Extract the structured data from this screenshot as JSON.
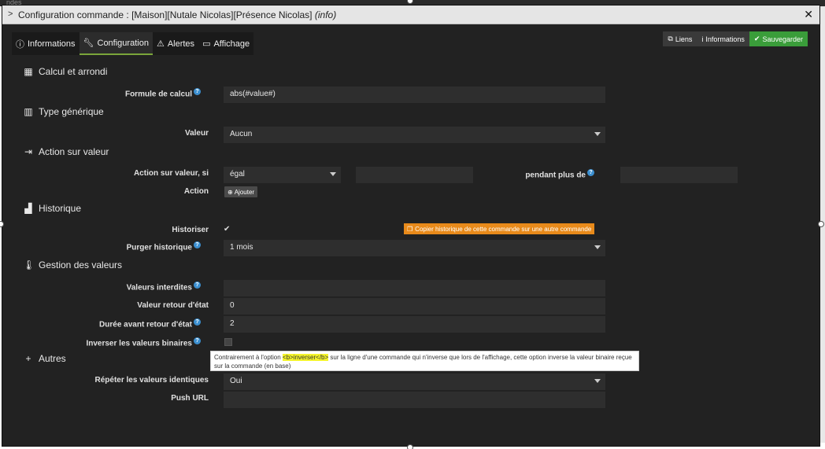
{
  "background": {
    "text": "ndes"
  },
  "title": {
    "prefix": "Configuration commande : [Maison][Nutale Nicolas][Présence Nicolas]",
    "suffix": "(info)",
    "close": "✕"
  },
  "tabs": [
    {
      "label": "Informations",
      "icon": "info-circle-icon"
    },
    {
      "label": "Configuration",
      "icon": "wrench-icon"
    },
    {
      "label": "Alertes",
      "icon": "warning-icon"
    },
    {
      "label": "Affichage",
      "icon": "desktop-icon"
    }
  ],
  "actions": {
    "liens": "Liens",
    "informations": "Informations",
    "save": "Sauvegarder"
  },
  "sections": {
    "calcul": "Calcul et arrondi",
    "type": "Type générique",
    "action": "Action sur valeur",
    "historique": "Historique",
    "gestion": "Gestion des valeurs",
    "autres": "Autres"
  },
  "fields": {
    "formule": {
      "label": "Formule de calcul",
      "value": "abs(#value#)"
    },
    "valeur": {
      "label": "Valeur",
      "value": "Aucun"
    },
    "action_si": {
      "label": "Action sur valeur, si",
      "value": "égal",
      "pendant": "pendant plus de"
    },
    "action": {
      "label": "Action",
      "button": "Ajouter"
    },
    "historiser": {
      "label": "Historiser",
      "copy": "Copier historique de cette commande sur une autre commande"
    },
    "purger": {
      "label": "Purger historique",
      "value": "1 mois"
    },
    "interdites": {
      "label": "Valeurs interdites",
      "value": ""
    },
    "retour": {
      "label": "Valeur retour d'état",
      "value": "0"
    },
    "duree": {
      "label": "Durée avant retour d'état",
      "value": "2"
    },
    "inverser": {
      "label": "Inverser les valeurs binaires"
    },
    "repeter": {
      "label": "Répéter les valeurs identiques",
      "value": "Oui"
    },
    "push": {
      "label": "Push URL",
      "value": ""
    }
  },
  "tooltip": {
    "before": "Contrairement à l'option ",
    "highlight": "<b>inverser</b>",
    "after": " sur la ligne d'une commande qui n'inverse que lors de l'affichage, cette option inverse la valeur binaire reçue sur la commande (en base)"
  },
  "colors": {
    "accent": "#7aa53a",
    "save": "#3a9d3a",
    "copy": "#e88a1a",
    "help": "#3b8fd0"
  }
}
